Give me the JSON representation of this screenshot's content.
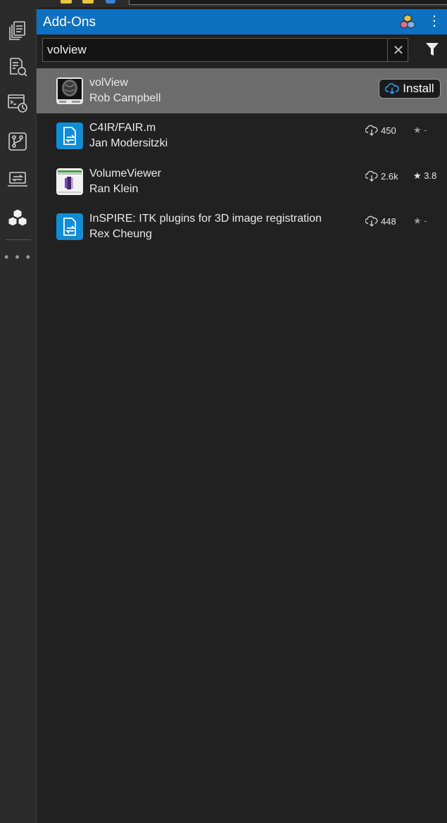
{
  "panel": {
    "title": "Add-Ons",
    "menu_glyph": "⋮"
  },
  "search": {
    "value": "volview",
    "clear_glyph": "✕"
  },
  "activity_bar": {
    "items": [
      {
        "icon": "files-icon"
      },
      {
        "icon": "find-files-icon"
      },
      {
        "icon": "command-history-icon"
      },
      {
        "icon": "source-control-icon"
      },
      {
        "icon": "project-terminal-icon"
      },
      {
        "icon": "add-ons-icon"
      }
    ],
    "more_glyph": "• • •"
  },
  "results": [
    {
      "name": "volView",
      "author": "Rob Campbell",
      "selected": true,
      "action": "Install",
      "thumbnail": "brain-scan-thumbnail"
    },
    {
      "name": "C4IR/FAIR.m",
      "author": "Jan Modersitzki",
      "downloads": "450",
      "rating": "★ -",
      "thumbnail": "toolbox-file-icon"
    },
    {
      "name": "VolumeViewer",
      "author": "Ran Klein",
      "downloads": "2.6k",
      "rating": "★ 3.8",
      "thumbnail": "volume-viewer-thumbnail"
    },
    {
      "name": "InSPIRE: ITK plugins for 3D image registration",
      "author": "Rex Cheung",
      "downloads": "448",
      "rating": "★ -",
      "thumbnail": "toolbox-file-icon"
    }
  ],
  "colors": {
    "header": "#0e70c0",
    "selected_row": "#6c6c6c",
    "background": "#212121"
  }
}
